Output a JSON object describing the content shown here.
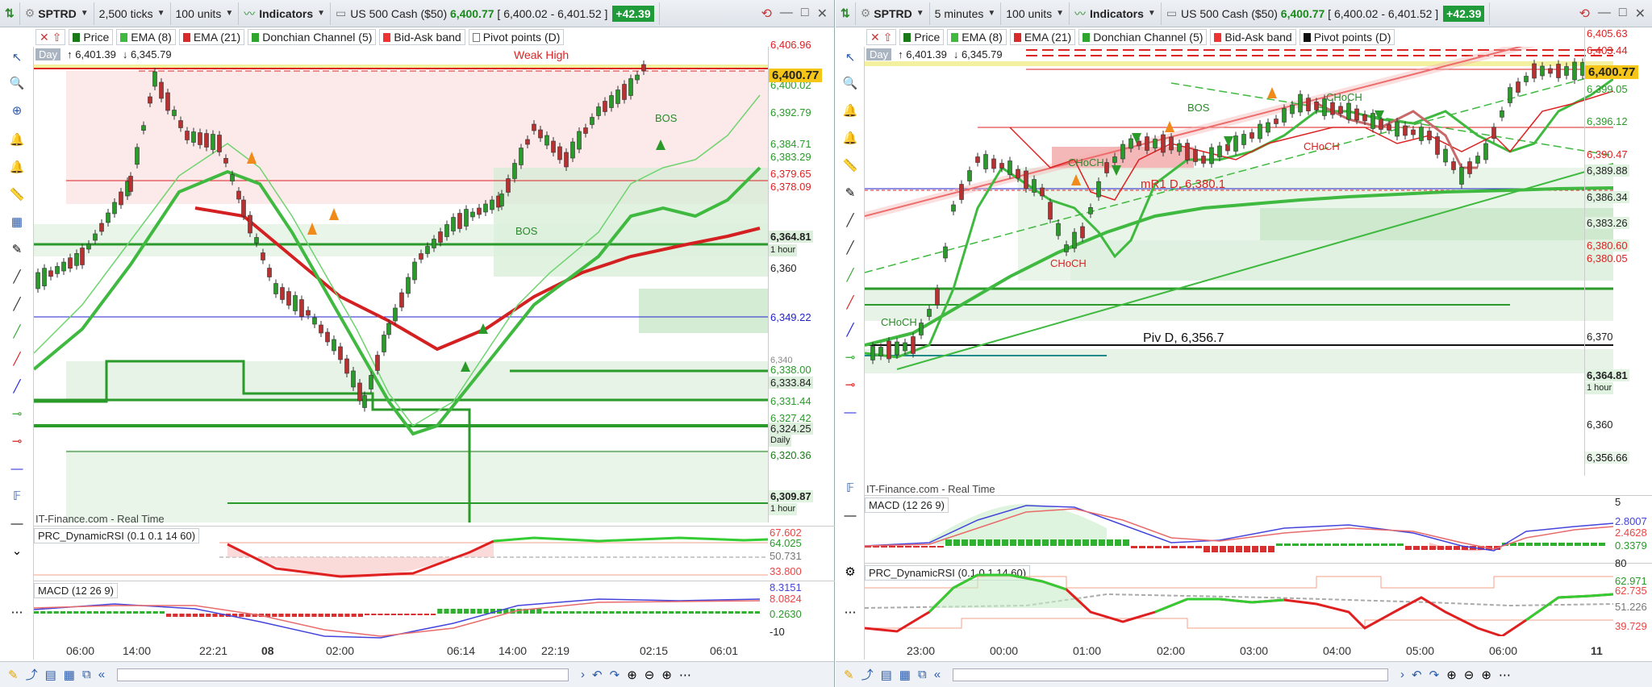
{
  "left": {
    "symbol": "SPTRD",
    "interval": "2,500 ticks",
    "units": "100 units",
    "indicators_label": "Indicators",
    "instrument": "US 500 Cash ($50)",
    "last": "6,400.77",
    "bid_ask": "6,400.02 - 6,401.52",
    "change": "+42.39",
    "legend": [
      "Price",
      "EMA (8)",
      "EMA (21)",
      "Donchian Channel (5)",
      "Bid-Ask band",
      "Pivot points (D)"
    ],
    "day_label": "Day",
    "day_high": "↑ 6,401.39",
    "day_low": "↓ 6,345.79",
    "annotation_weak_high": "Weak High",
    "bos1": "BOS",
    "bos2": "BOS",
    "price_labels": [
      "6,406.96",
      "6,400.02",
      "6,392.79",
      "6,384.71",
      "6,383.29",
      "6,379.65",
      "6,378.09",
      "6,364.81",
      "1 hour",
      "6,360",
      "6,349.22",
      "6,340",
      "6,338.00",
      "6,333.84",
      "6,331.44",
      "6,327.42",
      "6,324.25",
      "Daily",
      "6,320.36",
      "6,309.87",
      "1 hour"
    ],
    "last_label": "6,400.77",
    "watermark": "IT-Finance.com - Real Time",
    "rsi_title": "PRC_DynamicRSI (0.1 0.1 14 60)",
    "rsi_labels": [
      "67.602",
      "64.025",
      "50.731",
      "33.800"
    ],
    "macd_title": "MACD (12 26 9)",
    "macd_labels": [
      "8.3151",
      "8.0824",
      "0.2630",
      "-10"
    ],
    "time_labels": [
      "06:00",
      "14:00",
      "22:21",
      "08",
      "02:00",
      "06:14",
      "14:00",
      "22:19",
      "02:15",
      "06:01"
    ]
  },
  "right": {
    "symbol": "SPTRD",
    "interval": "5 minutes",
    "units": "100 units",
    "indicators_label": "Indicators",
    "instrument": "US 500 Cash ($50)",
    "last": "6,400.77",
    "bid_ask": "6,400.02 - 6,401.52",
    "change": "+42.39",
    "legend": [
      "Price",
      "EMA (8)",
      "EMA (21)",
      "Donchian Channel (5)",
      "Bid-Ask band",
      "Pivot points (D)"
    ],
    "day_label": "Day",
    "day_high": "↑ 6,401.39",
    "day_low": "↓ 6,345.79",
    "choch1": "CHoCH",
    "choch2": "CHoCH",
    "choch3": "CHoCH",
    "choch4": "CHoCH",
    "choch5": "CHoCH",
    "bos": "BOS",
    "mr1": "mR1 D, 6,380.1",
    "piv": "Piv D, 6,356.7",
    "price_labels": [
      "6,405.63",
      "6,403.44",
      "6,399.05",
      "6,396.12",
      "6,390.47",
      "6,389.88",
      "6,386.34",
      "6,383.26",
      "6,380.60",
      "6,380.05",
      "6,370",
      "6,364.81",
      "1 hour",
      "6,360",
      "6,356.66"
    ],
    "last_label": "6,400.77",
    "watermark": "IT-Finance.com - Real Time",
    "macd_title": "MACD (12 26 9)",
    "macd_labels": [
      "5",
      "2.8007",
      "2.4628",
      "0.3379"
    ],
    "rsi_title": "PRC_DynamicRSI (0.1 0.1 14 60)",
    "rsi_labels": [
      "80",
      "62.971",
      "62.735",
      "51.226",
      "39.729"
    ],
    "time_labels": [
      "23:00",
      "00:00",
      "01:00",
      "02:00",
      "03:00",
      "04:00",
      "05:00",
      "06:00",
      "11"
    ]
  }
}
